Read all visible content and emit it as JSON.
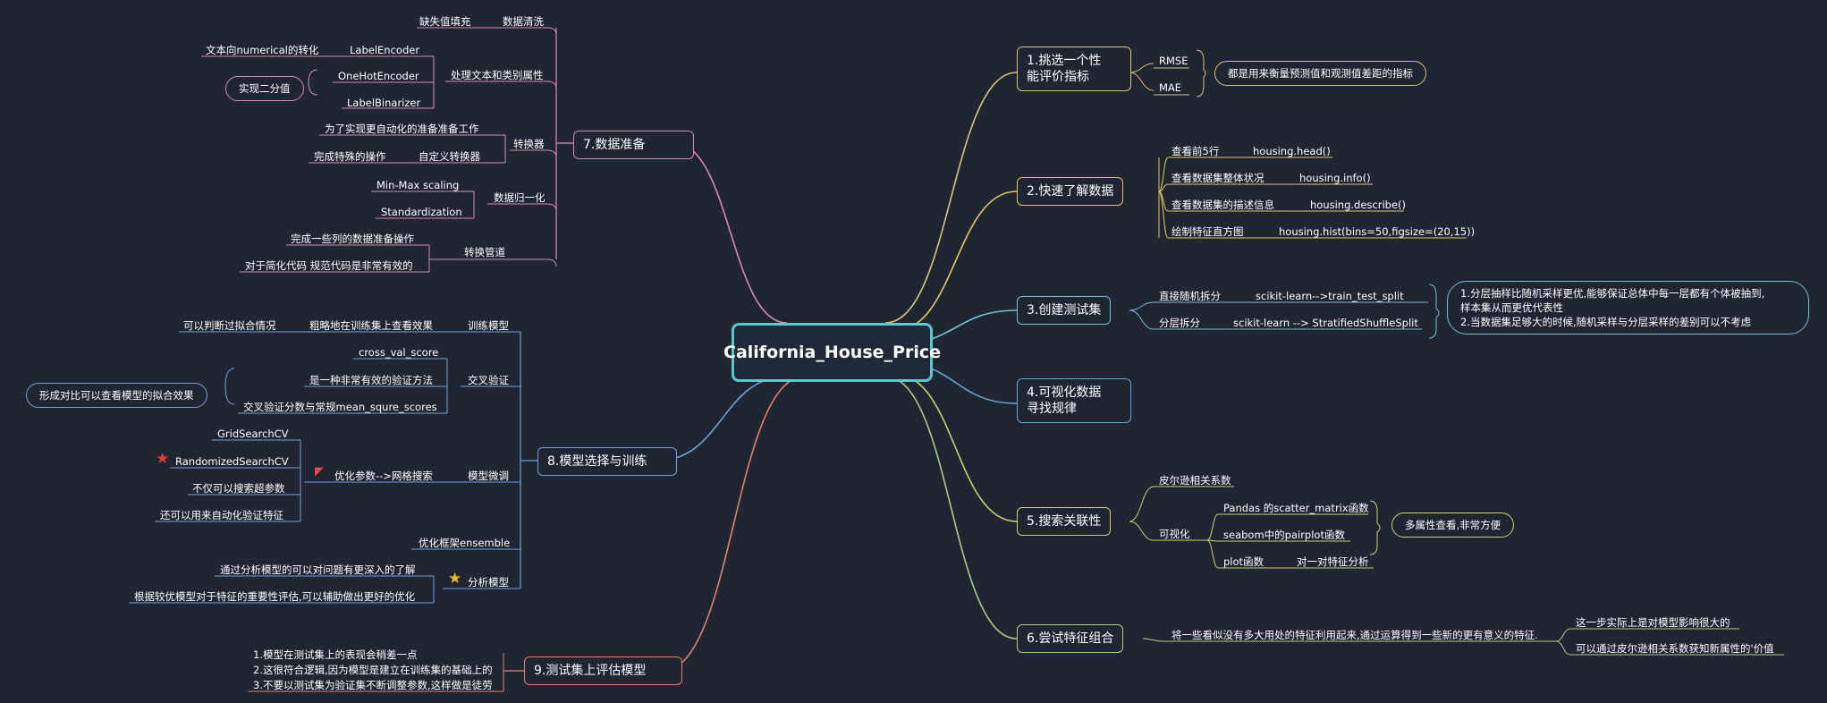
{
  "center": {
    "label": "California_House_Price"
  },
  "colors": {
    "background": "#1f2533",
    "center": "#5fc7c9",
    "b1": "#d9c476",
    "b2": "#e2c85c",
    "b3": "#6ec3d1",
    "b4": "#5aa8d0",
    "b5": "#c4d56a",
    "b6": "#a8cf7d",
    "b7": "#d98aa8",
    "b8": "#6aa5d9",
    "b9": "#e0836a"
  },
  "branches": {
    "b1": {
      "label_lines": [
        "1.挑选一个性",
        "能评价指标"
      ],
      "items": [
        "RMSE",
        "MAE"
      ],
      "note": "都是用来衡量预测值和观测值差距的指标"
    },
    "b2": {
      "label": "2.快速了解数据",
      "items": [
        {
          "text": "查看前5行",
          "code": "housing.head()"
        },
        {
          "text": "查看数据集整体状况",
          "code": "housing.info()"
        },
        {
          "text": "查看数据集的描述信息",
          "code": "housing.describe()"
        },
        {
          "text": "绘制特征直方图",
          "code": "housing.hist(bins=50,figsize=(20,15))"
        }
      ]
    },
    "b3": {
      "label": "3.创建测试集",
      "items": [
        {
          "text": "直接随机拆分",
          "code": "scikit-learn-->train_test_split"
        },
        {
          "text": "分层拆分",
          "code": "scikit-learn --> StratifiedShuffleSplit"
        }
      ],
      "note_lines": [
        "1.分层抽样比随机采样更优,能够保证总体中每一层都有个体被抽到,",
        "样本集从而更优代表性",
        "2.当数据集足够大的时候,随机采样与分层采样的差别可以不考虑"
      ]
    },
    "b4": {
      "label_lines": [
        "4.可视化数据",
        "寻找规律"
      ]
    },
    "b5": {
      "label": "5.搜索关联性",
      "items": [
        "皮尔逊相关系数",
        "可视化"
      ],
      "sub": [
        "Pandas 的scatter_matrix函数",
        "seabom中的pairplot函数",
        "plot函数"
      ],
      "sub_extra": "对一对特征分析",
      "note": "多属性查看,非常方便"
    },
    "b6": {
      "label": "6.尝试特征组合",
      "item": "将一些看似没有多大用处的特征利用起来,通过运算得到一些新的更有意义的特征.",
      "notes": [
        "这一步实际上是对模型影响很大的",
        "可以通过皮尔逊相关系数获知新属性的'价值"
      ]
    },
    "b7": {
      "label": "7.数据准备",
      "groups": {
        "clean": {
          "label": "数据清洗",
          "item": "缺失值填充"
        },
        "text": {
          "label": "处理文本和类别属性",
          "items": [
            "LabelEncoder",
            "OneHotEncoder",
            "LabelBinarizer"
          ],
          "label_encoder_desc": "文本向numerical的转化",
          "binary_note": "实现二分值"
        },
        "transformer": {
          "label": "转换器",
          "items": [
            "为了实现更自动化的准备准备工作",
            "自定义转换器"
          ],
          "custom_desc": "完成特殊的操作"
        },
        "scale": {
          "label": "数据归一化",
          "items": [
            "Min-Max scaling",
            "Standardization"
          ]
        },
        "pipeline": {
          "label": "转换管道",
          "items": [
            "完成一些列的数据准备操作",
            "对于简化代码 规范代码是非常有效的"
          ]
        }
      }
    },
    "b8": {
      "label": "8.模型选择与训练",
      "groups": {
        "train": {
          "label": "训练模型",
          "item": "粗略地在训练集上查看效果",
          "desc": "可以判断过拟合情况"
        },
        "cv": {
          "label": "交叉验证",
          "items": [
            "cross_val_score",
            "是一种非常有效的验证方法",
            "交叉验证分数与常规mean_squre_scores"
          ],
          "note": "形成对比可以查看模型的拟合效果"
        },
        "tune": {
          "label": "模型微调",
          "item": "优化参数-->网格搜索",
          "subs": [
            "GridSearchCV",
            "RandomizedSearchCV",
            "不仅可以搜索超参数",
            "还可以用来自动化验证特征"
          ]
        },
        "ensemble": {
          "label": "优化框架ensemble"
        },
        "analyze": {
          "label": "分析模型",
          "items": [
            "通过分析模型的可以对问题有更深入的了解",
            "根据较优模型对于特征的重要性评估,可以辅助做出更好的优化"
          ]
        }
      }
    },
    "b9": {
      "label": "9.测试集上评估模型",
      "items": [
        "1.模型在测试集上的表现会稍差一点",
        "2.这很符合逻辑,因为模型是建立在训练集的基础上的",
        "3.不要以测试集为验证集不断调整参数,这样做是徒劳"
      ]
    }
  }
}
